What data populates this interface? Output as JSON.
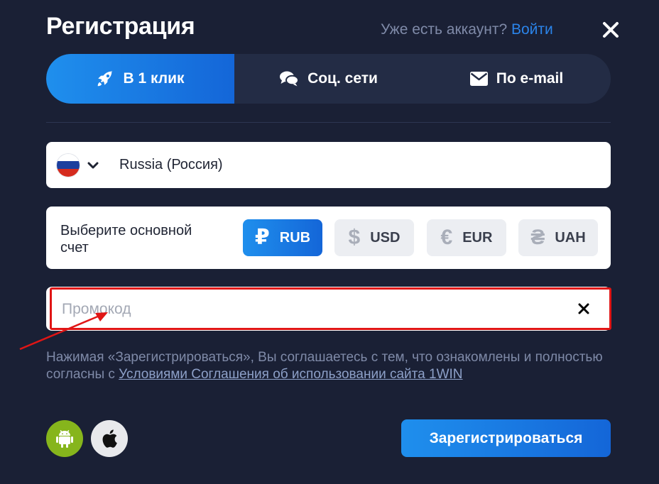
{
  "header": {
    "title": "Регистрация",
    "have_account": "Уже есть аккаунт?",
    "login_link": "Войти"
  },
  "tabs": [
    {
      "label": "В 1 клик",
      "icon": "rocket-icon",
      "active": true
    },
    {
      "label": "Соц. сети",
      "icon": "chat-bubbles-icon",
      "active": false
    },
    {
      "label": "По e-mail",
      "icon": "envelope-icon",
      "active": false
    }
  ],
  "country": {
    "name": "Russia (Россия)",
    "flag_colors": [
      "#ffffff",
      "#1c3f9e",
      "#d52b1e"
    ]
  },
  "currency": {
    "label": "Выберите основной счет",
    "options": [
      {
        "code": "RUB",
        "symbol": "₽",
        "selected": true
      },
      {
        "code": "USD",
        "symbol": "$",
        "selected": false
      },
      {
        "code": "EUR",
        "symbol": "€",
        "selected": false
      },
      {
        "code": "UAH",
        "symbol": "₴",
        "selected": false
      }
    ]
  },
  "promo": {
    "placeholder": "Промокод",
    "value": ""
  },
  "agreement": {
    "text": "Нажимая «Зарегистрироваться», Вы соглашаетесь с тем, что ознакомлены и полностью согласны с ",
    "terms_link": "Условиями Соглашения об использовании сайта 1WIN"
  },
  "footer": {
    "register_label": "Зарегистрироваться"
  },
  "colors": {
    "background": "#1a2035",
    "accent": "#1f8fed",
    "highlight": "#e01515",
    "android": "#86b51c"
  }
}
